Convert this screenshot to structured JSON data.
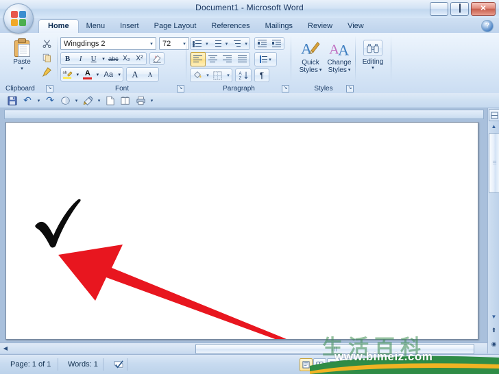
{
  "window": {
    "title": "Document1 - Microsoft Word",
    "controls": {
      "minimize": "Minimize",
      "maximize": "Maximize",
      "close": "✕"
    }
  },
  "office_button": {
    "label": "Office Button"
  },
  "tabs": [
    {
      "label": "Home",
      "active": true
    },
    {
      "label": "Menu",
      "active": false
    },
    {
      "label": "Insert",
      "active": false
    },
    {
      "label": "Page Layout",
      "active": false
    },
    {
      "label": "References",
      "active": false
    },
    {
      "label": "Mailings",
      "active": false
    },
    {
      "label": "Review",
      "active": false
    },
    {
      "label": "View",
      "active": false
    }
  ],
  "help": {
    "label": "?"
  },
  "ribbon": {
    "clipboard": {
      "group_label": "Clipboard",
      "paste_label": "Paste",
      "paste_caret": "▾",
      "cut_label": "Cut",
      "copy_label": "Copy",
      "format_painter_label": "Format Painter",
      "dialog_launcher": "↘"
    },
    "font": {
      "group_label": "Font",
      "font_name": "Wingdings 2",
      "font_size": "72",
      "caret": "▾",
      "bold": "B",
      "italic": "I",
      "underline": "U",
      "strikethrough": "abc",
      "subscript": "X₂",
      "superscript": "X²",
      "change_case": "Aa",
      "clear_formatting": "A",
      "highlight": "ab",
      "font_color": "A",
      "grow_font": "A",
      "shrink_font": "A",
      "dialog_launcher": "↘"
    },
    "paragraph": {
      "group_label": "Paragraph",
      "bullets": "Bullets",
      "numbering": "Numbering",
      "multilevel": "Multilevel List",
      "decrease_indent": "Decrease Indent",
      "increase_indent": "Increase Indent",
      "align_left": "Align Left",
      "center": "Center",
      "align_right": "Align Right",
      "justify": "Justify",
      "line_spacing": "Line Spacing",
      "shading": "Shading",
      "borders": "Borders",
      "sort": "Sort",
      "show_marks": "¶",
      "caret": "▾",
      "dialog_launcher": "↘"
    },
    "styles": {
      "group_label": "Styles",
      "quick_styles_line1": "Quick",
      "quick_styles_line2": "Styles",
      "change_styles_line1": "Change",
      "change_styles_line2": "Styles",
      "caret": "▾",
      "dialog_launcher": "↘"
    },
    "editing": {
      "group_label": "Editing",
      "label": "Editing",
      "caret": "▾"
    }
  },
  "quick_access": {
    "items": [
      {
        "name": "save-icon",
        "glyph": "💾"
      },
      {
        "name": "undo-icon",
        "glyph": "↶"
      },
      {
        "name": "undo-caret",
        "glyph": "▾"
      },
      {
        "name": "redo-icon",
        "glyph": "↷"
      },
      {
        "name": "print-preview-icon",
        "glyph": "◔"
      },
      {
        "name": "print-preview-caret",
        "glyph": "▾"
      },
      {
        "name": "format-painter-icon",
        "glyph": "✎"
      },
      {
        "name": "format-painter-caret",
        "glyph": "▾"
      },
      {
        "name": "new-document-icon",
        "glyph": "□"
      },
      {
        "name": "open-icon",
        "glyph": "◫"
      },
      {
        "name": "print-icon",
        "glyph": "⎙"
      },
      {
        "name": "customize-caret",
        "glyph": "▾"
      }
    ]
  },
  "document": {
    "checkmark_alt": "black check mark character typed in Wingdings 2",
    "arrow_alt": "red arrow pointing at the check mark",
    "checkmark_color": "#0c0c0c",
    "arrow_color": "#e8161f"
  },
  "scrollbars": {
    "vertical": {
      "select_browse_object": "◉",
      "up_arrow": "▲",
      "down_arrow": "▼",
      "previous_page": "⬆",
      "next_page": "⬇",
      "thumb_grip": "☰"
    },
    "horizontal": {
      "left_arrow": "◀",
      "thumb_grip": "||||"
    }
  },
  "status_bar": {
    "page": "Page: 1 of 1",
    "words": "Words: 1",
    "proofing_icon": "✓",
    "views": [
      {
        "name": "print-layout-view",
        "glyph": "▤",
        "active": true
      },
      {
        "name": "full-screen-reading-view",
        "glyph": "❐",
        "active": false
      },
      {
        "name": "web-layout-view",
        "glyph": "▦",
        "active": false
      },
      {
        "name": "outline-view",
        "glyph": "≡",
        "active": false
      },
      {
        "name": "draft-view",
        "glyph": "▥",
        "active": false
      }
    ]
  },
  "watermark": {
    "chinese": "生活百科",
    "url": "www.bimeiz.com"
  },
  "colors": {
    "accent": "#1b3a63",
    "arrow_red": "#e8161f",
    "tab_active_bg": "#ffffff",
    "chrome_blue": "#c3d5ec"
  }
}
